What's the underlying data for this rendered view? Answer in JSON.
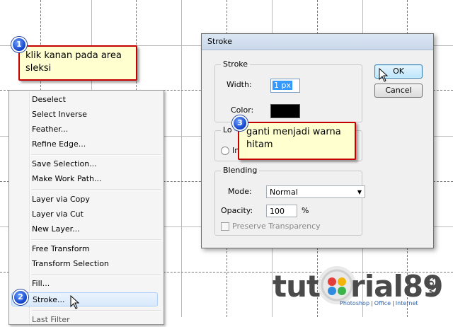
{
  "context_menu": {
    "items": [
      {
        "label": "Deselect"
      },
      {
        "label": "Select Inverse"
      },
      {
        "label": "Feather..."
      },
      {
        "label": "Refine Edge..."
      },
      {
        "label": "Save Selection..."
      },
      {
        "label": "Make Work Path..."
      },
      {
        "label": "Layer via Copy"
      },
      {
        "label": "Layer via Cut"
      },
      {
        "label": "New Layer..."
      },
      {
        "label": "Free Transform"
      },
      {
        "label": "Transform Selection"
      },
      {
        "label": "Fill..."
      },
      {
        "label": "Stroke..."
      },
      {
        "label": "Last Filter"
      }
    ],
    "highlighted": "Stroke..."
  },
  "dialog": {
    "title": "Stroke",
    "stroke_group": {
      "legend": "Stroke",
      "width_label": "Width:",
      "width_value": "1 px",
      "color_label": "Color:",
      "color_value": "#000000"
    },
    "location_group": {
      "legend": "Lo",
      "radio_label": "In"
    },
    "blending_group": {
      "legend": "Blending",
      "mode_label": "Mode:",
      "mode_value": "Normal",
      "opacity_label": "Opacity:",
      "opacity_value": "100",
      "opacity_unit": "%",
      "preserve_label": "Preserve Transparency"
    },
    "ok_label": "OK",
    "cancel_label": "Cancel"
  },
  "callouts": {
    "step1": {
      "badge": "1",
      "text": "klik kanan pada area sleksi"
    },
    "step2": {
      "badge": "2"
    },
    "step3": {
      "badge": "3",
      "text": "ganti menjadi warna hitam"
    }
  },
  "watermark": {
    "brand_left": "tut",
    "brand_right": "rial89",
    "suffix": "COM",
    "sub_items": [
      "Photoshop",
      "Office",
      "Internet"
    ],
    "sub_sep": "|"
  },
  "colors": {
    "callout_border": "#c40000",
    "callout_fill": "#ffffd0",
    "badge": "#1040c8"
  }
}
